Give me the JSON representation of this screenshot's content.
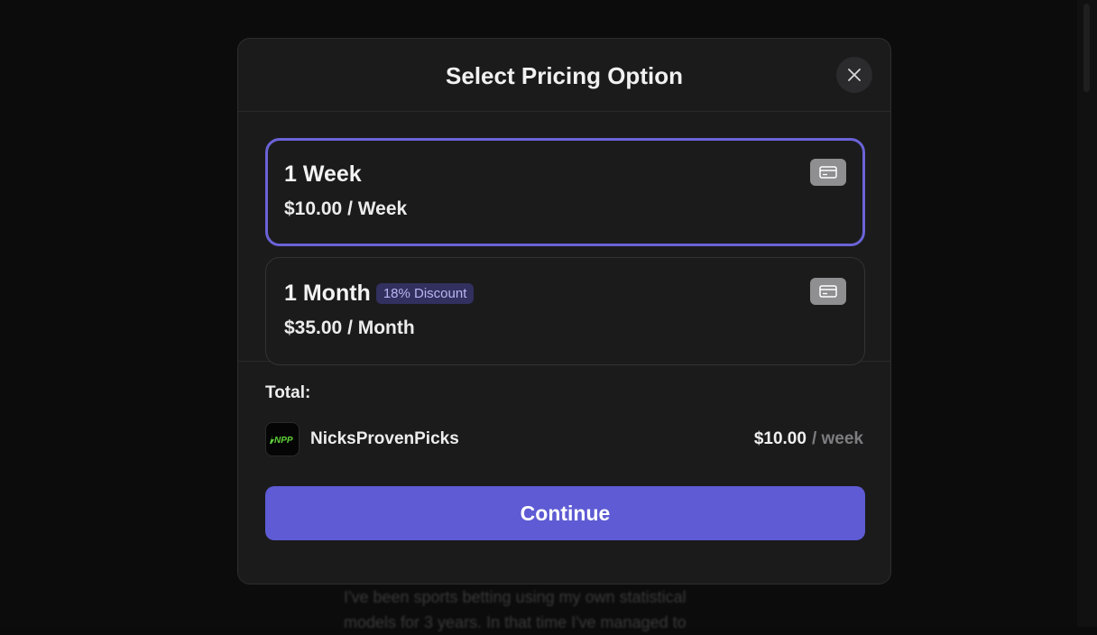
{
  "background": {
    "text": "I've been sports betting using my own statistical models for 3 years. In that time I've managed to"
  },
  "modal": {
    "title": "Select Pricing Option",
    "close_icon": "close-icon",
    "options": [
      {
        "name": "1 Week",
        "price": "$10.00 / Week",
        "badge": "",
        "selected": true,
        "icon": "credit-card-icon"
      },
      {
        "name": "1 Month",
        "price": "$35.00 / Month",
        "badge": "18% Discount",
        "selected": false,
        "icon": "credit-card-icon"
      }
    ],
    "summary": {
      "total_label": "Total:",
      "product_name": "NicksProvenPicks",
      "logo_text": "NPP",
      "price": "$10.00",
      "period": "/ week"
    },
    "continue_label": "Continue"
  },
  "colors": {
    "accent": "#5e5bd4",
    "selected_border": "#6a63d6",
    "badge_bg": "#31305e",
    "badge_text": "#b9b6f3",
    "logo_accent": "#5fd13a"
  }
}
